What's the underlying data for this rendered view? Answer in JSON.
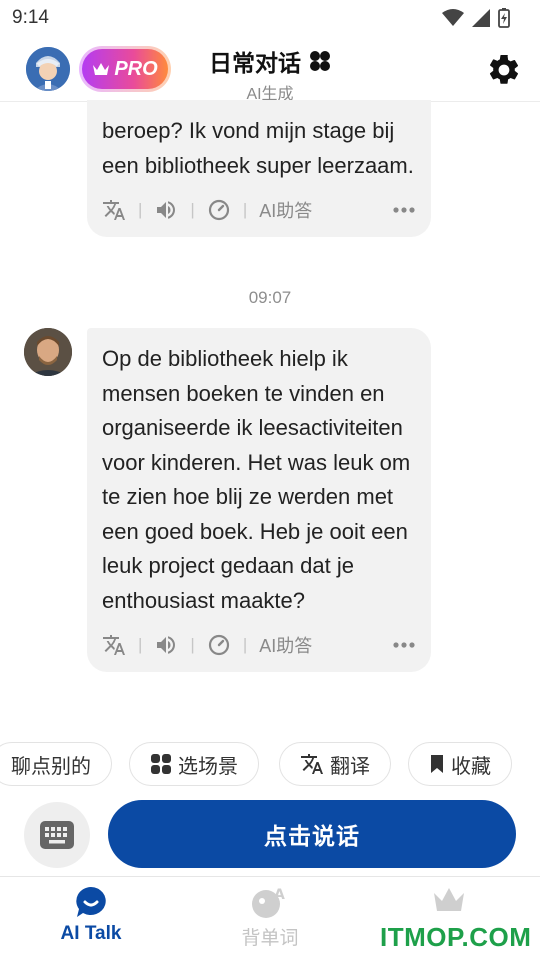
{
  "status_bar": {
    "time": "9:14"
  },
  "header": {
    "pro_label": "PRO",
    "title": "日常对话",
    "subtitle": "AI生成"
  },
  "messages": [
    {
      "text": "beroep? Ik vond mijn stage bij een bibliotheek super leerzaam.",
      "actions": {
        "ai_answer": "AI助答"
      }
    },
    {
      "timestamp": "09:07"
    },
    {
      "text": "Op de bibliotheek hielp ik mensen boeken te vinden en organiseerde ik leesactiviteiten voor kinderen. Het was leuk om te zien hoe blij ze werden met een goed boek. Heb je ooit een leuk project gedaan dat je enthousiast maakte?",
      "actions": {
        "ai_answer": "AI助答"
      }
    }
  ],
  "chips": [
    {
      "label": "聊点别的"
    },
    {
      "label": "选场景",
      "icon": "grid-icon"
    },
    {
      "label": "翻译",
      "icon": "translate-icon"
    },
    {
      "label": "收藏",
      "icon": "bookmark-icon"
    }
  ],
  "talk_button": {
    "label": "点击说话"
  },
  "bottom_nav": [
    {
      "label": "AI Talk",
      "icon": "chat-bubble-icon",
      "active": true
    },
    {
      "label": "背单词",
      "icon": "vocabulary-icon",
      "active": false
    },
    {
      "label": "",
      "icon": "crown-icon",
      "active": false
    }
  ],
  "watermark": {
    "text": "ITMOP.COM"
  },
  "colors": {
    "primary": "#0b4aa4",
    "bubble_bg": "#f2f2f2",
    "watermark": "#1ea04a"
  }
}
